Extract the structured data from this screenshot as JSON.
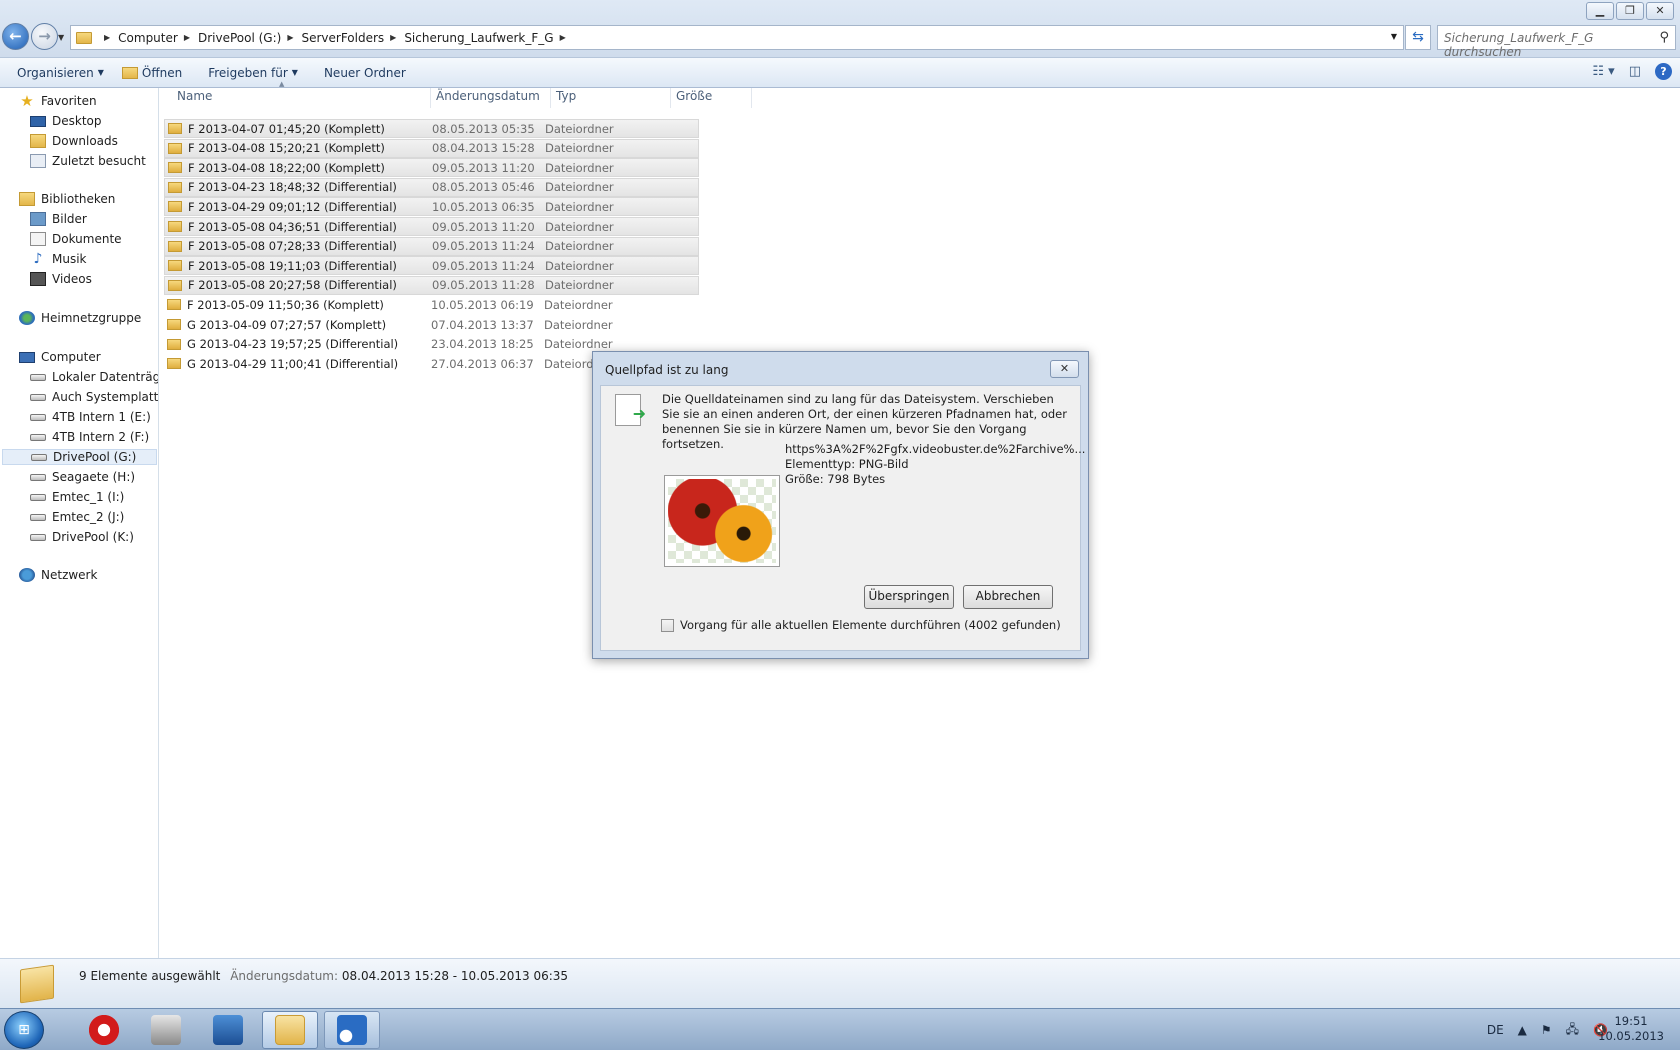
{
  "window": {
    "caption_buttons": [
      "▁",
      "❐",
      "✕"
    ]
  },
  "address": {
    "breadcrumbs": [
      "Computer",
      "DrivePool (G:)",
      "ServerFolders",
      "Sicherung_Laufwerk_F_G"
    ],
    "search_placeholder": "Sicherung_Laufwerk_F_G durchsuchen"
  },
  "toolbar": {
    "organize": "Organisieren",
    "open": "Öffnen",
    "share": "Freigeben für",
    "new_folder": "Neuer Ordner"
  },
  "sidebar": {
    "favorites": {
      "label": "Favoriten",
      "items": [
        "Desktop",
        "Downloads",
        "Zuletzt besucht"
      ]
    },
    "libraries": {
      "label": "Bibliotheken",
      "items": [
        "Bilder",
        "Dokumente",
        "Musik",
        "Videos"
      ]
    },
    "homegroup": "Heimnetzgruppe",
    "computer": {
      "label": "Computer",
      "items": [
        "Lokaler Datenträger",
        "Auch Systemplatte (",
        "4TB Intern 1 (E:)",
        "4TB Intern 2 (F:)",
        "DrivePool (G:)",
        "Seagaete (H:)",
        "Emtec_1 (I:)",
        "Emtec_2 (J:)",
        "DrivePool (K:)"
      ],
      "selected_index": 4
    },
    "network": "Netzwerk"
  },
  "columns": [
    "Name",
    "Änderungsdatum",
    "Typ",
    "Größe"
  ],
  "files": [
    {
      "name": "F 2013-04-07 01;45;20 (Komplett)",
      "date": "08.05.2013 05:35",
      "type": "Dateiordner",
      "selected": true
    },
    {
      "name": "F 2013-04-08 15;20;21 (Komplett)",
      "date": "08.04.2013 15:28",
      "type": "Dateiordner",
      "selected": true
    },
    {
      "name": "F 2013-04-08 18;22;00 (Komplett)",
      "date": "09.05.2013 11:20",
      "type": "Dateiordner",
      "selected": true
    },
    {
      "name": "F 2013-04-23 18;48;32 (Differential)",
      "date": "08.05.2013 05:46",
      "type": "Dateiordner",
      "selected": true
    },
    {
      "name": "F 2013-04-29 09;01;12 (Differential)",
      "date": "10.05.2013 06:35",
      "type": "Dateiordner",
      "selected": true
    },
    {
      "name": "F 2013-05-08 04;36;51 (Differential)",
      "date": "09.05.2013 11:20",
      "type": "Dateiordner",
      "selected": true
    },
    {
      "name": "F 2013-05-08 07;28;33 (Differential)",
      "date": "09.05.2013 11:24",
      "type": "Dateiordner",
      "selected": true
    },
    {
      "name": "F 2013-05-08 19;11;03 (Differential)",
      "date": "09.05.2013 11:24",
      "type": "Dateiordner",
      "selected": true
    },
    {
      "name": "F 2013-05-08 20;27;58 (Differential)",
      "date": "09.05.2013 11:28",
      "type": "Dateiordner",
      "selected": true
    },
    {
      "name": "F 2013-05-09 11;50;36 (Komplett)",
      "date": "10.05.2013 06:19",
      "type": "Dateiordner",
      "selected": false
    },
    {
      "name": "G 2013-04-09 07;27;57 (Komplett)",
      "date": "07.04.2013 13:37",
      "type": "Dateiordner",
      "selected": false
    },
    {
      "name": "G 2013-04-23 19;57;25 (Differential)",
      "date": "23.04.2013 18:25",
      "type": "Dateiordner",
      "selected": false
    },
    {
      "name": "G 2013-04-29 11;00;41 (Differential)",
      "date": "27.04.2013 06:37",
      "type": "Dateiordner",
      "selected": false
    }
  ],
  "status": {
    "selection": "9 Elemente ausgewählt",
    "date_label": "Änderungsdatum:",
    "date_range": "08.04.2013 15:28 - 10.05.2013 06:35"
  },
  "dialog": {
    "title": "Quellpfad ist zu lang",
    "message": "Die Quelldateinamen sind zu lang für das Dateisystem. Verschieben Sie sie an einen anderen Ort, der einen kürzeren Pfadnamen hat, oder benennen Sie sie in kürzere Namen um, bevor Sie den Vorgang fortsetzen.",
    "file_name": "https%3A%2F%2Fgfx.videobuster.de%2Farchive%...",
    "file_type": "Elementtyp: PNG-Bild",
    "file_size": "Größe: 798 Bytes",
    "skip_button": "Überspringen",
    "cancel_button": "Abbrechen",
    "apply_all": "Vorgang für alle aktuellen Elemente durchführen (4002 gefunden)"
  },
  "taskbar": {
    "language": "DE",
    "time": "19:51",
    "date": "10.05.2013"
  }
}
